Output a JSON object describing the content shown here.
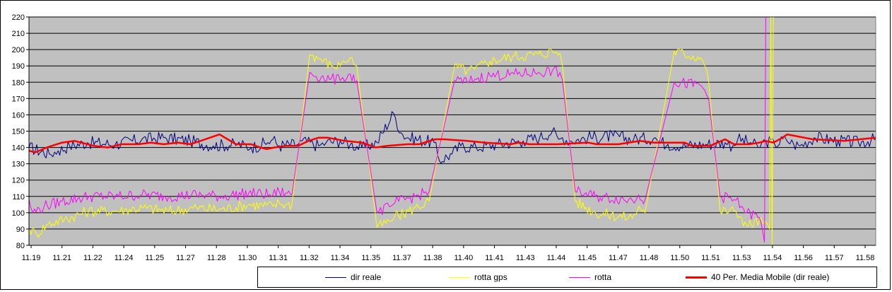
{
  "chart_data": {
    "type": "line",
    "title": "",
    "xlabel": "",
    "ylabel": "",
    "ylim": [
      80,
      220
    ],
    "yticks": [
      80,
      90,
      100,
      110,
      120,
      130,
      140,
      150,
      160,
      170,
      180,
      190,
      200,
      210,
      220
    ],
    "ytick_labels": [
      "80",
      "90",
      "100",
      "110",
      "120",
      "130",
      "140",
      "150",
      "160",
      "170",
      "180",
      "190",
      "200",
      "210",
      "220"
    ],
    "xrange_minutes": [
      11.3167,
      11.9833
    ],
    "xtick_labels": [
      "11.19",
      "11.21",
      "11.22",
      "11.24",
      "11.25",
      "11.27",
      "11.28",
      "11.30",
      "11.31",
      "11.32",
      "11.34",
      "11.35",
      "11.37",
      "11.38",
      "11.40",
      "11.41",
      "11.43",
      "11.44",
      "11.45",
      "11.47",
      "11.48",
      "11.50",
      "11.51",
      "11.53",
      "11.54",
      "11.56",
      "11.57",
      "11.58"
    ],
    "grid": true,
    "background_color": "#c0c0c0",
    "legend_position": "bottom-right",
    "series": [
      {
        "name": "dir reale",
        "color": "#000080",
        "x": [
          11.3167,
          11.3327,
          11.3397,
          11.3487,
          11.3627,
          11.3847,
          11.4057,
          11.4227,
          11.4437,
          11.4617,
          11.4807,
          11.4917,
          11.5047,
          11.5087,
          11.5137,
          11.5287,
          11.5317,
          11.5447,
          11.5507,
          11.5617,
          11.5697,
          11.5787,
          11.5907,
          11.6037,
          11.6097,
          11.6147,
          11.6357,
          11.6397,
          11.6497,
          11.6567,
          11.6687,
          11.6857,
          11.7057,
          11.7187,
          11.7287,
          11.7337,
          11.7367,
          11.7427,
          11.7567,
          11.7767,
          11.7927,
          11.8097,
          11.8117,
          11.8197,
          11.8347,
          11.8497,
          11.8647,
          11.8707,
          11.8747,
          11.8847,
          11.8907,
          11.8967,
          11.9037,
          11.9127,
          11.9187,
          11.9237,
          11.9347,
          11.9537,
          11.9697,
          11.9833
        ],
        "y": [
          140,
          136,
          138,
          141,
          143,
          142,
          145,
          146,
          144,
          141,
          142,
          140,
          143,
          145,
          141,
          142,
          144,
          141,
          143,
          144,
          142,
          140,
          143,
          161,
          149,
          146,
          143,
          132,
          136,
          141,
          140,
          142,
          144,
          146,
          150,
          145,
          146,
          144,
          146,
          147,
          145,
          146,
          144,
          142,
          141,
          142,
          143,
          141,
          145,
          143,
          140,
          144,
          142,
          145,
          142,
          141,
          146,
          144,
          143,
          145
        ]
      },
      {
        "name": "rotta gps",
        "color": "#ffff00",
        "x": [
          11.3167,
          11.3227,
          11.3317,
          11.3447,
          11.3637,
          11.3847,
          11.4057,
          11.4267,
          11.4487,
          11.4687,
          11.4897,
          11.5087,
          11.5137,
          11.5187,
          11.5237,
          11.5377,
          11.5467,
          11.5547,
          11.5617,
          11.5637,
          11.5697,
          11.5747,
          11.5907,
          11.6017,
          11.6047,
          11.6077,
          11.6207,
          11.6317,
          11.6517,
          11.6617,
          11.6677,
          11.6797,
          11.6987,
          11.7177,
          11.7287,
          11.7347,
          11.7367,
          11.7467,
          11.7627,
          11.7887,
          11.7947,
          11.7967,
          11.8017,
          11.8247,
          11.8457,
          11.8487,
          11.8517,
          11.8607,
          11.8717,
          11.8777,
          11.8817,
          11.8917,
          11.8997,
          11.9007,
          11.9017,
          11.9027
        ],
        "y": [
          90,
          87,
          93,
          96,
          101,
          101,
          103,
          101,
          103,
          102,
          105,
          104,
          106,
          105,
          105,
          197,
          194,
          190,
          190,
          193,
          195,
          190,
          91,
          95,
          98,
          98,
          103,
          107,
          190,
          187,
          188,
          193,
          196,
          197,
          199,
          198,
          190,
          107,
          100,
          97,
          99,
          104,
          100,
          199,
          195,
          190,
          181,
          101,
          101,
          97,
          92,
          95,
          90,
          220,
          80,
          220
        ]
      },
      {
        "name": "rotta",
        "color": "#ff00ff",
        "x": [
          11.3167,
          11.3197,
          11.3287,
          11.3427,
          11.3637,
          11.3847,
          11.4057,
          11.4267,
          11.4487,
          11.4687,
          11.4897,
          11.5087,
          11.5137,
          11.5187,
          11.5237,
          11.5377,
          11.5467,
          11.5547,
          11.5617,
          11.5637,
          11.5697,
          11.5747,
          11.5907,
          11.6017,
          11.6047,
          11.6077,
          11.6207,
          11.6317,
          11.6517,
          11.6617,
          11.6677,
          11.6797,
          11.6987,
          11.7177,
          11.7287,
          11.7347,
          11.7367,
          11.7467,
          11.7627,
          11.7887,
          11.7947,
          11.7967,
          11.8017,
          11.8247,
          11.8457,
          11.8487,
          11.8517,
          11.8607,
          11.8717,
          11.8777,
          11.8817,
          11.8917,
          11.8957,
          11.8967
        ],
        "y": [
          108,
          100,
          104,
          107,
          110,
          110,
          111,
          110,
          111,
          110,
          112,
          111,
          113,
          112,
          111,
          186,
          183,
          182,
          181,
          183,
          185,
          181,
          100,
          104,
          106,
          107,
          110,
          113,
          181,
          180,
          182,
          184,
          185,
          186,
          187,
          186,
          181,
          113,
          110,
          108,
          108,
          111,
          108,
          180,
          178,
          175,
          170,
          110,
          108,
          104,
          100,
          97,
          82,
          220
        ]
      },
      {
        "name": "40 Per. Media Mobile (dir reale)",
        "color": "#ff0000",
        "x": [
          11.3167,
          11.3217,
          11.3307,
          11.3427,
          11.3527,
          11.3677,
          11.3787,
          11.3897,
          11.4027,
          11.4127,
          11.4227,
          11.4337,
          11.4437,
          11.4517,
          11.4667,
          11.4797,
          11.4917,
          11.4987,
          11.5037,
          11.5097,
          11.5187,
          11.5287,
          11.5367,
          11.5447,
          11.5517,
          11.5657,
          11.5787,
          11.5827,
          11.5897,
          11.5987,
          11.6147,
          11.6237,
          11.6367,
          11.6437,
          11.6617,
          11.6757,
          11.6957,
          11.7027,
          11.7107,
          11.7327,
          11.7567,
          11.7637,
          11.7807,
          11.7977,
          11.8087,
          11.8327,
          11.8387,
          11.8527,
          11.8647,
          11.8717,
          11.8837,
          11.8917,
          11.8967,
          11.9027,
          11.9077,
          11.9137,
          11.9337,
          11.9587,
          11.9833
        ],
        "y": [
          138,
          137,
          140,
          143,
          144,
          141,
          140,
          142,
          142,
          143,
          142,
          143,
          142,
          144,
          148,
          142,
          142,
          140,
          139,
          140,
          141,
          141,
          144,
          146,
          146,
          144,
          143,
          142,
          140,
          141,
          142,
          142,
          145,
          145,
          144,
          143,
          142,
          143,
          142,
          142,
          143,
          142,
          142,
          144,
          143,
          143,
          141,
          141,
          145,
          142,
          142,
          143,
          144,
          143,
          145,
          148,
          145,
          144,
          146
        ]
      }
    ]
  }
}
